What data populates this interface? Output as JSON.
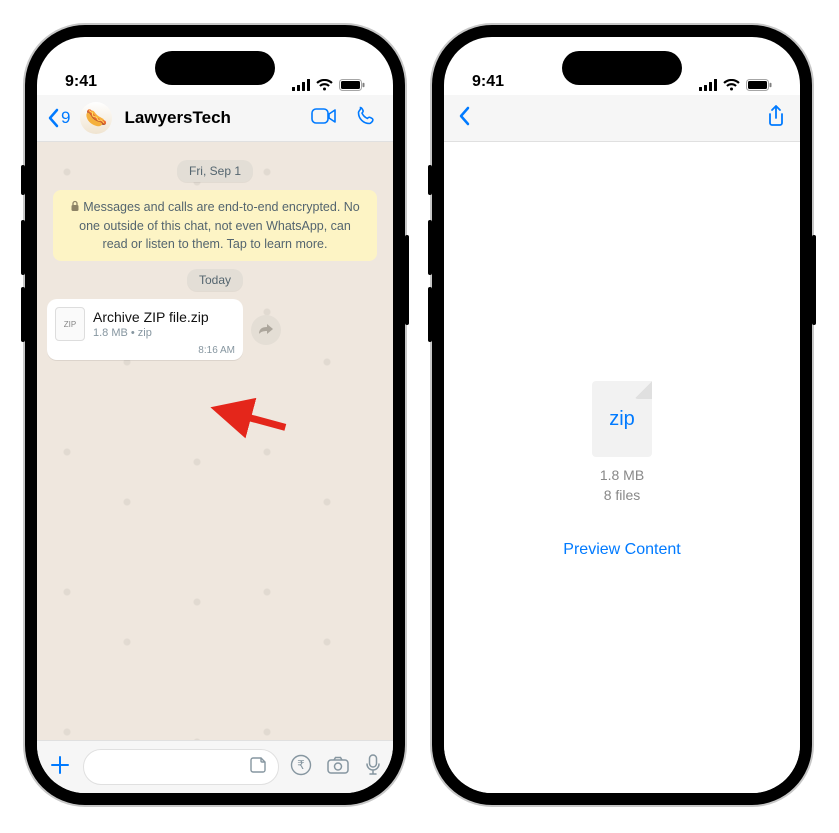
{
  "status_time": "9:41",
  "left": {
    "back_count": "9",
    "avatar_emoji": "🌭",
    "chat_title": "LawyersTech",
    "date1": "Fri, Sep 1",
    "encryption_text": "Messages and calls are end-to-end encrypted. No one outside of this chat, not even WhatsApp, can read or listen to them. Tap to learn more.",
    "date2": "Today",
    "file_name": "Archive ZIP file.zip",
    "file_meta": "1.8 MB • zip",
    "msg_time": "8:16 AM"
  },
  "right": {
    "zip_label": "zip",
    "file_size": "1.8 MB",
    "file_count": "8 files",
    "preview_label": "Preview Content"
  }
}
